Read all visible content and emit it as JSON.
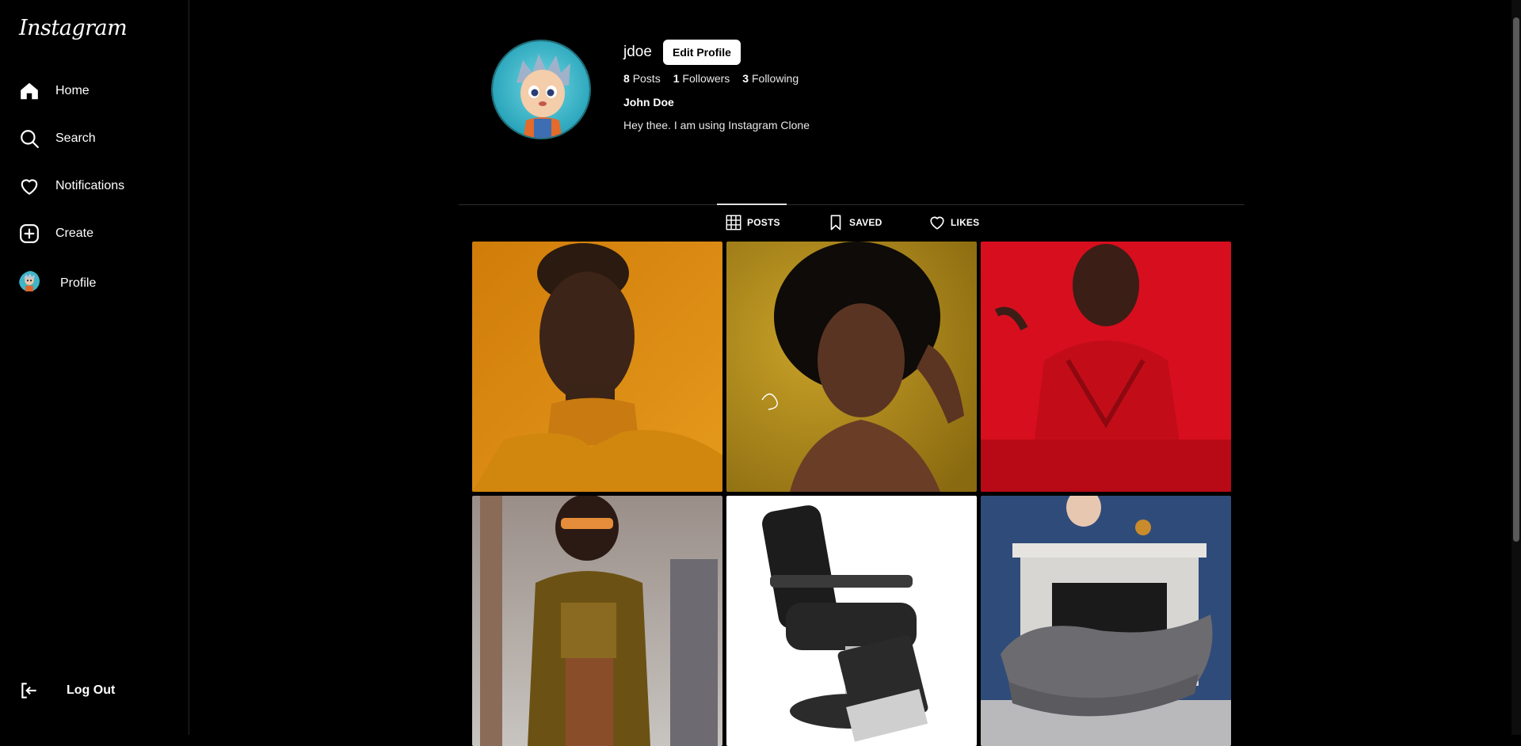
{
  "brand": {
    "logo_text": "Instagram"
  },
  "sidebar": {
    "items": [
      {
        "label": "Home",
        "icon": "home-icon"
      },
      {
        "label": "Search",
        "icon": "search-icon"
      },
      {
        "label": "Notifications",
        "icon": "heart-icon"
      },
      {
        "label": "Create",
        "icon": "plus-square-icon"
      },
      {
        "label": "Profile",
        "icon": "avatar"
      }
    ],
    "logout": {
      "label": "Log Out",
      "icon": "logout-icon"
    }
  },
  "profile": {
    "username": "jdoe",
    "edit_label": "Edit Profile",
    "posts_count": "8",
    "posts_label": "Posts",
    "followers_count": "1",
    "followers_label": "Followers",
    "following_count": "3",
    "following_label": "Following",
    "full_name": "John Doe",
    "bio": "Hey thee. I am using Instagram Clone"
  },
  "tabs": [
    {
      "label": "POSTS",
      "icon": "grid-icon",
      "active": true
    },
    {
      "label": "SAVED",
      "icon": "bookmark-icon",
      "active": false
    },
    {
      "label": "LIKES",
      "icon": "heart-icon",
      "active": false
    }
  ],
  "posts": [
    {
      "subject": "portrait-orange"
    },
    {
      "subject": "portrait-gold"
    },
    {
      "subject": "portrait-red"
    },
    {
      "subject": "street-fashion"
    },
    {
      "subject": "barber-chair"
    },
    {
      "subject": "grey-sofa"
    }
  ],
  "colors": {
    "background": "#000000",
    "divider": "#262626",
    "button_bg": "#ffffff"
  }
}
